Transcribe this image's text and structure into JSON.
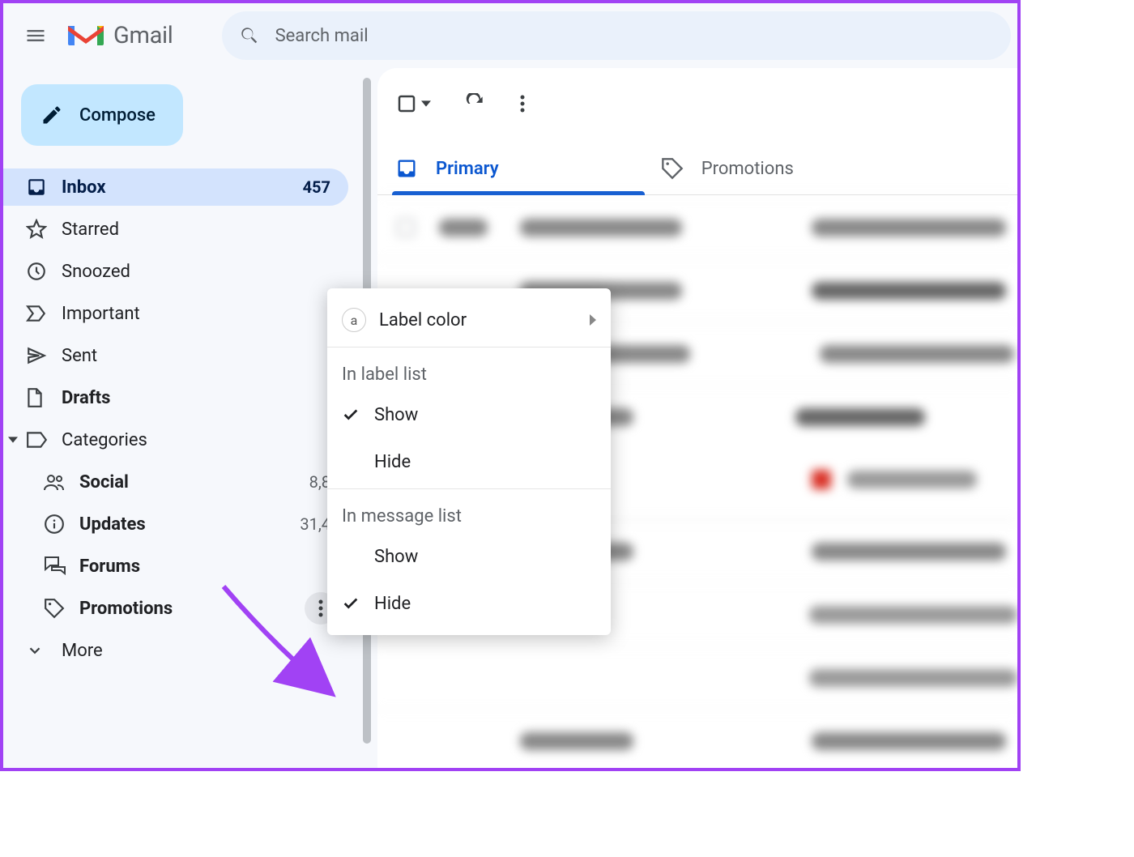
{
  "product": {
    "name": "Gmail"
  },
  "search": {
    "placeholder": "Search mail"
  },
  "compose": {
    "label": "Compose"
  },
  "sidebar": {
    "items": [
      {
        "id": "inbox",
        "label": "Inbox",
        "count": "457"
      },
      {
        "id": "starred",
        "label": "Starred"
      },
      {
        "id": "snoozed",
        "label": "Snoozed"
      },
      {
        "id": "important",
        "label": "Important"
      },
      {
        "id": "sent",
        "label": "Sent"
      },
      {
        "id": "drafts",
        "label": "Drafts"
      },
      {
        "id": "categories",
        "label": "Categories"
      }
    ],
    "categories": [
      {
        "id": "social",
        "label": "Social",
        "count": "8,8"
      },
      {
        "id": "updates",
        "label": "Updates",
        "count": "31,4"
      },
      {
        "id": "forums",
        "label": "Forums"
      },
      {
        "id": "promotions",
        "label": "Promotions"
      }
    ],
    "more": {
      "label": "More"
    }
  },
  "tabs": [
    {
      "id": "primary",
      "label": "Primary"
    },
    {
      "id": "promotions",
      "label": "Promotions"
    }
  ],
  "context_menu": {
    "label_color": "Label color",
    "section1_title": "In label list",
    "section1": {
      "show": "Show",
      "hide": "Hide"
    },
    "section2_title": "In message list",
    "section2": {
      "show": "Show",
      "hide": "Hide"
    }
  }
}
